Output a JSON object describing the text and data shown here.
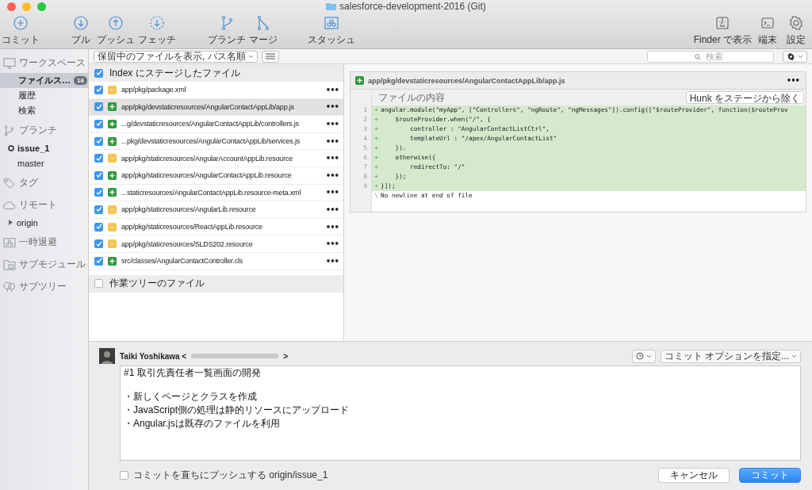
{
  "window": {
    "title": "salesforce-development-2016 (Git)"
  },
  "toolbar": {
    "groups": [
      [
        {
          "label": "コミット",
          "kind": "commit"
        }
      ],
      [
        {
          "label": "プル",
          "kind": "pull"
        },
        {
          "label": "プッシュ",
          "kind": "push"
        },
        {
          "label": "フェッチ",
          "kind": "fetch"
        }
      ],
      [
        {
          "label": "ブランチ",
          "kind": "branch"
        },
        {
          "label": "マージ",
          "kind": "merge"
        }
      ],
      [
        {
          "label": "スタッシュ",
          "kind": "stash"
        }
      ]
    ],
    "right": [
      {
        "label": "Finder で表示",
        "kind": "finder"
      },
      {
        "label": "端末",
        "kind": "terminal"
      },
      {
        "label": "設定",
        "kind": "settings"
      }
    ]
  },
  "sidebar": {
    "sections": [
      {
        "label": "ワークスペース",
        "kind": "workspace",
        "items": [
          {
            "label": "ファイルス…",
            "badge": "16",
            "selected": true
          },
          {
            "label": "履歴",
            "selected": false
          },
          {
            "label": "検索",
            "selected": false
          }
        ]
      },
      {
        "label": "ブランチ",
        "kind": "branch",
        "items": [
          {
            "label": "issue_1",
            "current": true,
            "selected": false
          },
          {
            "label": "master",
            "current": false,
            "selected": false
          }
        ]
      },
      {
        "label": "タグ",
        "kind": "tag"
      },
      {
        "label": "リモート",
        "kind": "remote",
        "items": [
          {
            "label": "origin",
            "expandable": true,
            "selected": false
          }
        ]
      },
      {
        "label": "一時退避",
        "kind": "stash"
      },
      {
        "label": "サブモジュール",
        "kind": "submodule"
      },
      {
        "label": "サブツリー",
        "kind": "subtree"
      }
    ]
  },
  "filter_bar": {
    "view_menu": "保留中のファイルを表示, パス名順",
    "search": {
      "placeholder": "検索"
    }
  },
  "staged": {
    "label": "Index にステージしたファイル",
    "checked": true,
    "files": [
      {
        "path": "app/pkg/package.xml",
        "kind": "modified",
        "checked": true,
        "selected": false,
        "menu": "•••"
      },
      {
        "path": "app/pkg/devstaticresources/AngularContactAppLib/app.js",
        "kind": "added",
        "checked": true,
        "selected": true,
        "menu": "•••"
      },
      {
        "path": "...g/devstaticresources/AngularContactAppLib/controllers.js",
        "kind": "added",
        "checked": true,
        "selected": false,
        "menu": "•••"
      },
      {
        "path": "...pkg/devstaticresources/AngularContactAppLib/services.js",
        "kind": "added",
        "checked": true,
        "selected": false,
        "menu": "•••"
      },
      {
        "path": "app/pkg/staticresources/AngularAccountAppLib.resource",
        "kind": "modified",
        "checked": true,
        "selected": false,
        "menu": "•••"
      },
      {
        "path": "app/pkg/staticresources/AngularContactAppLib.resource",
        "kind": "added",
        "checked": true,
        "selected": false,
        "menu": "•••"
      },
      {
        "path": "...staticresources/AngularContactAppLib.resource-meta.xml",
        "kind": "added",
        "checked": true,
        "selected": false,
        "menu": "•••"
      },
      {
        "path": "app/pkg/staticresources/AngularLib.resource",
        "kind": "modified",
        "checked": true,
        "selected": false,
        "menu": "•••"
      },
      {
        "path": "app/pkg/staticresources/ReactAppLib.resource",
        "kind": "modified",
        "checked": true,
        "selected": false,
        "menu": "•••"
      },
      {
        "path": "app/pkg/staticresources/SLDS202.resource",
        "kind": "modified",
        "checked": true,
        "selected": false,
        "menu": "•••"
      },
      {
        "path": "src/classes/AngularContactController.cls",
        "kind": "added",
        "checked": true,
        "selected": false,
        "menu": "•••"
      }
    ]
  },
  "unstaged": {
    "label": "作業ツリーのファイル",
    "checked": false
  },
  "diff": {
    "path": "app/pkg/devstaticresources/AngularContactAppLib/app.js",
    "kind": "added",
    "menu": "•••",
    "content_label": "ファイルの内容",
    "hunk_button": "Hunk をステージから除く",
    "lines": [
      {
        "number": "1",
        "marker": "+",
        "text": "angular.module(\"myApp\", [\"Controllers\", \"ngRoute\", \"ngMessages\"]).config([\"$routeProvider\", function($routeProv"
      },
      {
        "number": "2",
        "marker": "+",
        "text": "    $routeProvider.when(\"/\", {"
      },
      {
        "number": "3",
        "marker": "+",
        "text": "        controller : \"AngularContactListCtrl\","
      },
      {
        "number": "4",
        "marker": "+",
        "text": "        templateUrl : \"/apex/AngularContactList\""
      },
      {
        "number": "5",
        "marker": "+",
        "text": "    })."
      },
      {
        "number": "6",
        "marker": "+",
        "text": "    otherwise({"
      },
      {
        "number": "7",
        "marker": "+",
        "text": "        redirectTo: \"/\""
      },
      {
        "number": "8",
        "marker": "+",
        "text": "    });"
      },
      {
        "number": "9",
        "marker": "+",
        "text": "}]);"
      }
    ],
    "footer_marker": "\\",
    "footer": "No newline at end of file"
  },
  "commit": {
    "author": "Taiki Yoshikawa <",
    "author_end": ">",
    "options": "コミット オプションを指定...",
    "message": {
      "title": "#1 取引先責任者一覧画面の開発",
      "bullets": [
        "・新しくページとクラスを作成",
        "・JavaScript側の処理は静的リソースにアップロード",
        "・Angular.jsは既存のファイルを利用"
      ]
    },
    "push": {
      "label": "コミットを直ちにプッシュする origin/issue_1",
      "checked": false
    },
    "cancel": "キャンセル",
    "submit": "コミット"
  }
}
